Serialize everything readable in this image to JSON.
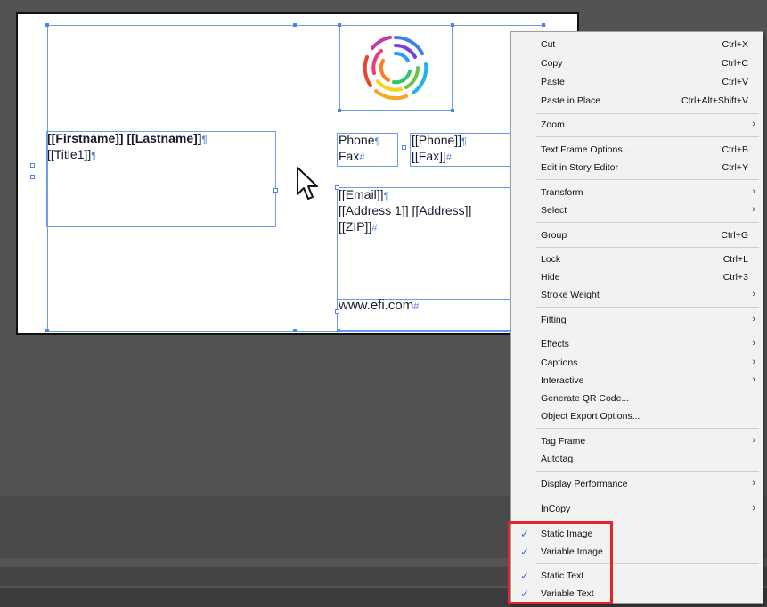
{
  "document": {
    "name_line": "[[Firstname]] [[Lastname]]",
    "title_line": "[[Title1]]",
    "phone_label": "Phone",
    "fax_label": "Fax",
    "phone_value": "[[Phone]]",
    "fax_value": "[[Fax]]",
    "email_line": "[[Email]]",
    "address_line": "[[Address 1]] [[Address]]",
    "zip_line": "[[ZIP]]",
    "website": "www.efi.com",
    "pilcrow": "¶",
    "end_mark": "#"
  },
  "context_menu": {
    "items": [
      {
        "label": "Cut",
        "shortcut": "Ctrl+X"
      },
      {
        "label": "Copy",
        "shortcut": "Ctrl+C"
      },
      {
        "label": "Paste",
        "shortcut": "Ctrl+V"
      },
      {
        "label": "Paste in Place",
        "shortcut": "Ctrl+Alt+Shift+V"
      },
      {
        "label": "Zoom"
      },
      {
        "label": "Text Frame Options...",
        "shortcut": "Ctrl+B"
      },
      {
        "label": "Edit in Story Editor",
        "shortcut": "Ctrl+Y"
      },
      {
        "label": "Transform"
      },
      {
        "label": "Select"
      },
      {
        "label": "Group",
        "shortcut": "Ctrl+G"
      },
      {
        "label": "Lock",
        "shortcut": "Ctrl+L"
      },
      {
        "label": "Hide",
        "shortcut": "Ctrl+3"
      },
      {
        "label": "Stroke Weight"
      },
      {
        "label": "Fitting"
      },
      {
        "label": "Effects"
      },
      {
        "label": "Captions"
      },
      {
        "label": "Interactive"
      },
      {
        "label": "Generate QR Code..."
      },
      {
        "label": "Object Export Options..."
      },
      {
        "label": "Tag Frame"
      },
      {
        "label": "Autotag"
      },
      {
        "label": "Display Performance"
      },
      {
        "label": "InCopy"
      },
      {
        "label": "Static Image",
        "checked": true
      },
      {
        "label": "Variable Image",
        "checked": true
      },
      {
        "label": "Static Text",
        "checked": true
      },
      {
        "label": "Variable Text",
        "checked": true
      }
    ],
    "submenu_arrow": "›",
    "check_glyph": "✓"
  },
  "colors": {
    "workspace": "#535353",
    "frame": "#6b9cf0",
    "highlight": "#e3262c"
  }
}
